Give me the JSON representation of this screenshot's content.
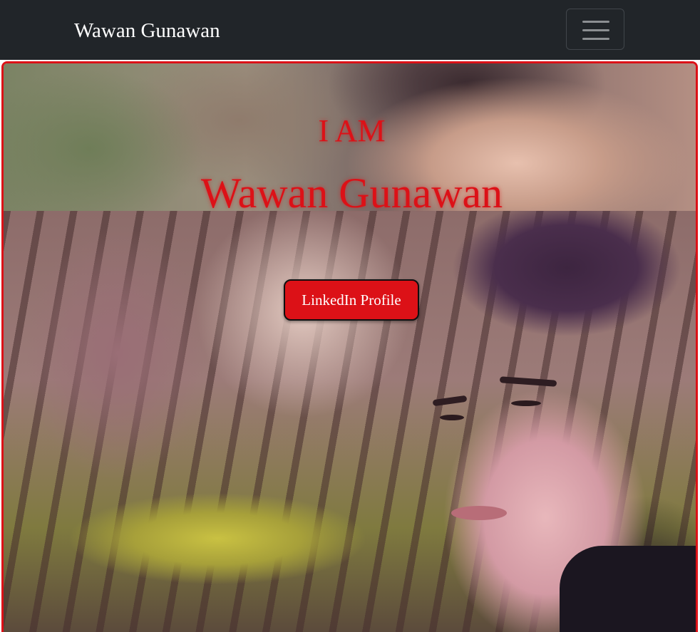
{
  "navbar": {
    "brand": "Wawan Gunawan",
    "toggler_icon": "hamburger-menu-icon"
  },
  "hero": {
    "kicker": "I AM",
    "name": "Wawan Gunawan",
    "cta_label": "LinkedIn Profile",
    "background_image": "portrait-photo"
  },
  "colors": {
    "navbar_bg": "#212529",
    "accent_red": "#dc1117",
    "brand_text": "#ffffff"
  }
}
